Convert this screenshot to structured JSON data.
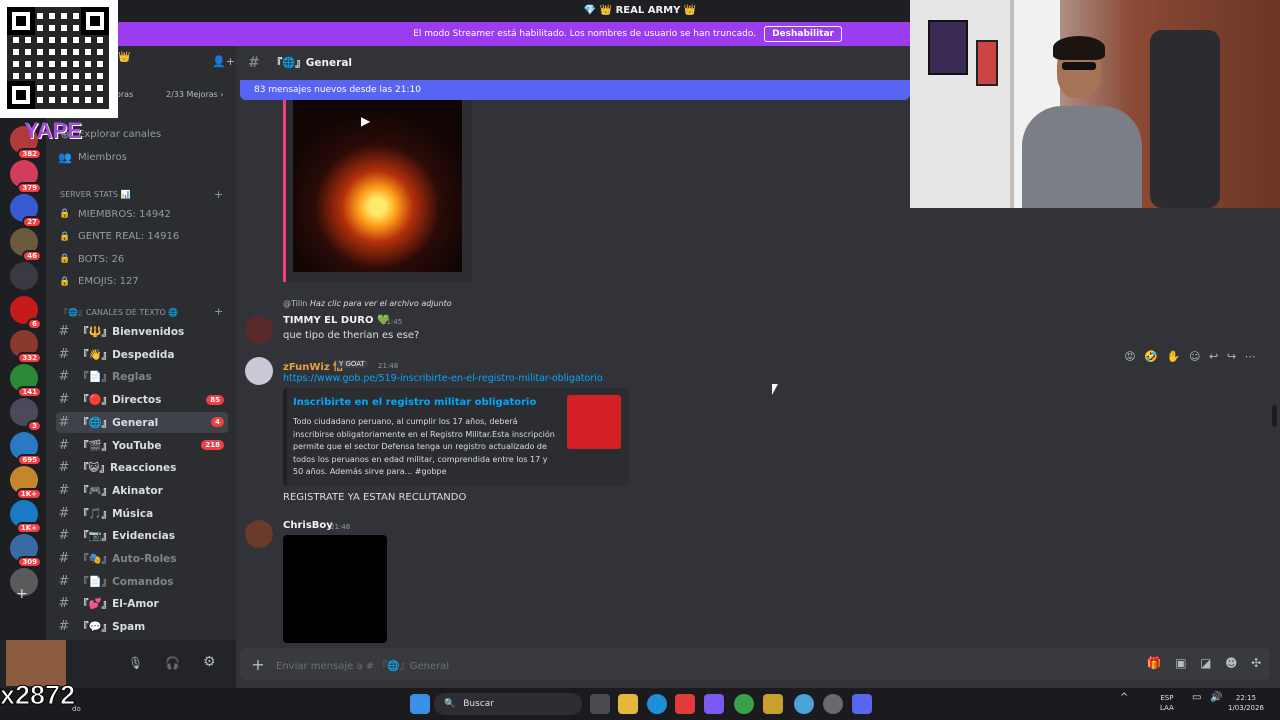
{
  "topbar": {
    "title": "💎 👑 REAL ARMY 👑"
  },
  "streamer_banner": {
    "text": "El modo Streamer está habilitado. Los nombres de usuario se han truncado.",
    "button": "Deshabilitar"
  },
  "server": {
    "name": "L ARMY 👑",
    "boost_left": "oras",
    "boost_right": "2/33 Mejoras ›"
  },
  "overlay": {
    "yape": "YAPE",
    "counter": "x2872",
    "mini_label": "do"
  },
  "guilds": [
    {
      "badge": "382",
      "color": "#b33a3a"
    },
    {
      "badge": "379",
      "color": "#d33c5a"
    },
    {
      "badge": "27",
      "color": "#3a5ad3"
    },
    {
      "badge": "46",
      "color": "#6a5a3a"
    },
    {
      "badge": "",
      "color": "#3a3a44"
    },
    {
      "badge": "6",
      "color": "#c41a1a"
    },
    {
      "badge": "332",
      "color": "#8a3a2a"
    },
    {
      "badge": "141",
      "color": "#2a8a3a"
    },
    {
      "badge": "3",
      "color": "#4a4a5a"
    },
    {
      "badge": "695",
      "color": "#2a7ac3"
    },
    {
      "badge": "1K+",
      "color": "#c3862a"
    },
    {
      "badge": "1K+",
      "color": "#1a7ac3"
    },
    {
      "badge": "309",
      "color": "#3a6aa3"
    },
    {
      "badge": "",
      "color": "#5a5a5a"
    }
  ],
  "sidebar_top": [
    {
      "icon": "⊕",
      "label": "Explorar canales"
    },
    {
      "icon": "👥",
      "label": "Miembros"
    }
  ],
  "stats_category": "SERVER STATS 📊",
  "stats": [
    "MIEMBROS: 14942",
    "GENTE REAL: 14916",
    "BOTS: 26",
    "EMOJIS: 127"
  ],
  "text_category": "『🌐』CANALES DE TEXTO 🌐",
  "channels": [
    {
      "label": "『🔱』Bienvenidos",
      "muted": false,
      "badge": ""
    },
    {
      "label": "『👋』Despedida",
      "muted": false,
      "badge": ""
    },
    {
      "label": "『📄』Reglas",
      "muted": true,
      "badge": ""
    },
    {
      "label": "『🔴』Directos",
      "muted": false,
      "badge": "85"
    },
    {
      "label": "『🌐』General",
      "muted": false,
      "badge": "4",
      "active": true
    },
    {
      "label": "『🎬』YouTube",
      "muted": false,
      "badge": "218"
    },
    {
      "label": "『😺』Reacciones",
      "muted": false,
      "badge": ""
    },
    {
      "label": "『🎮』Akinator",
      "muted": false,
      "badge": ""
    },
    {
      "label": "『🎵』Música",
      "muted": false,
      "badge": ""
    },
    {
      "label": "『📷』Evidencias",
      "muted": false,
      "badge": ""
    },
    {
      "label": "『🎭』Auto-Roles",
      "muted": true,
      "badge": ""
    },
    {
      "label": "『📄』Comandos",
      "muted": true,
      "badge": ""
    },
    {
      "label": "『💕』El-Amor",
      "muted": false,
      "badge": ""
    },
    {
      "label": "『💬』Spam",
      "muted": false,
      "badge": ""
    }
  ],
  "channel_header": "『🌐』General",
  "new_messages": "83 mensajes nuevos desde las 21:10",
  "messages": {
    "reply_user": "@Tilin",
    "reply_text": "Haz clic para ver el archivo adjunto",
    "m1_user": "TIMMY EL DURO 💚",
    "m1_time": "21:45",
    "m1_text": "que tipo de therian es ese?",
    "m2_user": "zFunWiz 悟",
    "m2_tag": "Y GOAT",
    "m2_time": "21:48",
    "m2_link": "https://www.gob.pe/519-inscribirte-en-el-registro-militar-obligatorio",
    "embed_title": "Inscribirte en el registro militar obligatorio",
    "embed_desc": "Todo ciudadano peruano, al cumplir los 17 años, deberá inscribirse obligatoriamente en el Registro Militar.Esta inscripción permite que el sector Defensa tenga un registro actualizado de todos los peruanos en edad militar, comprendida entre los 17 y 50 años. Además sirve para... #gobpe",
    "m2_extra": "REGISTRATE YA ESTAN RECLUTANDO",
    "m3_user": "ChrisBoy",
    "m3_time": "21:48"
  },
  "composer": {
    "placeholder": "Enviar mensaje a # 『🌐』General"
  },
  "taskbar": {
    "search": "Buscar",
    "lang1": "ESP",
    "lang2": "LAA",
    "time": "22:15",
    "date": "1/03/2026"
  }
}
